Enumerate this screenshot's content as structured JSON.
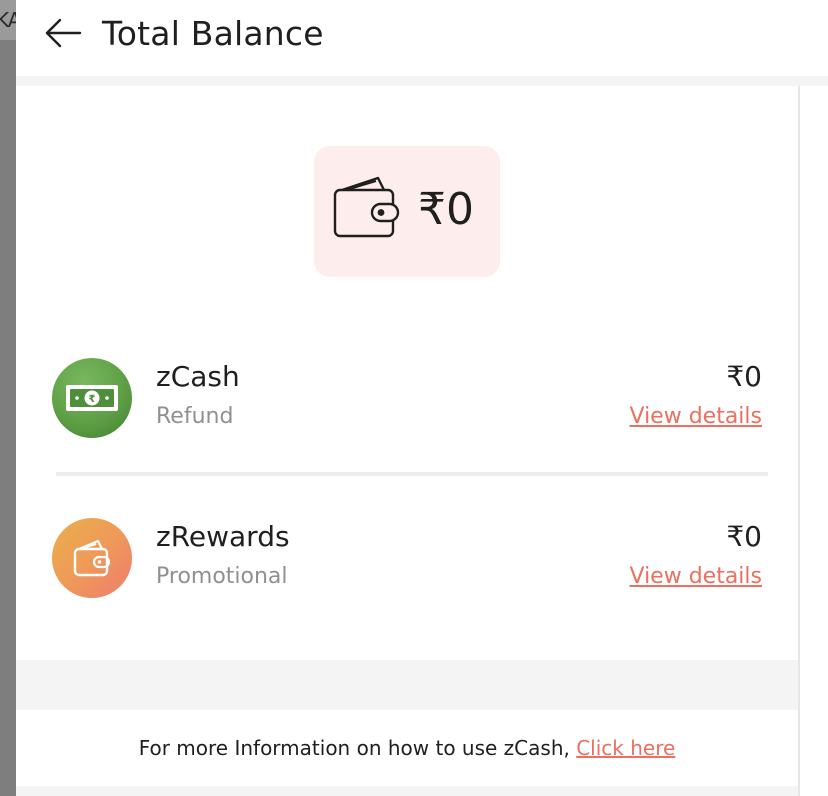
{
  "background": {
    "partial_text": "KA"
  },
  "header": {
    "title": "Total Balance",
    "back_icon": "arrow-left-icon"
  },
  "balance": {
    "amount": "₹0",
    "icon": "wallet-icon"
  },
  "accounts": [
    {
      "name": "zCash",
      "type": "Refund",
      "amount": "₹0",
      "link": "View details",
      "icon": "cash-note-icon",
      "color": "#5e9f45"
    },
    {
      "name": "zRewards",
      "type": "Promotional",
      "amount": "₹0",
      "link": "View details",
      "icon": "wallet-card-icon",
      "color": "#ee9a58"
    }
  ],
  "footer": {
    "text": "For more Information on how to use zCash, ",
    "link": "Click here"
  },
  "colors": {
    "accent": "#ec6f5f",
    "balance_bg": "#fdeeed",
    "subtext": "#909090"
  }
}
